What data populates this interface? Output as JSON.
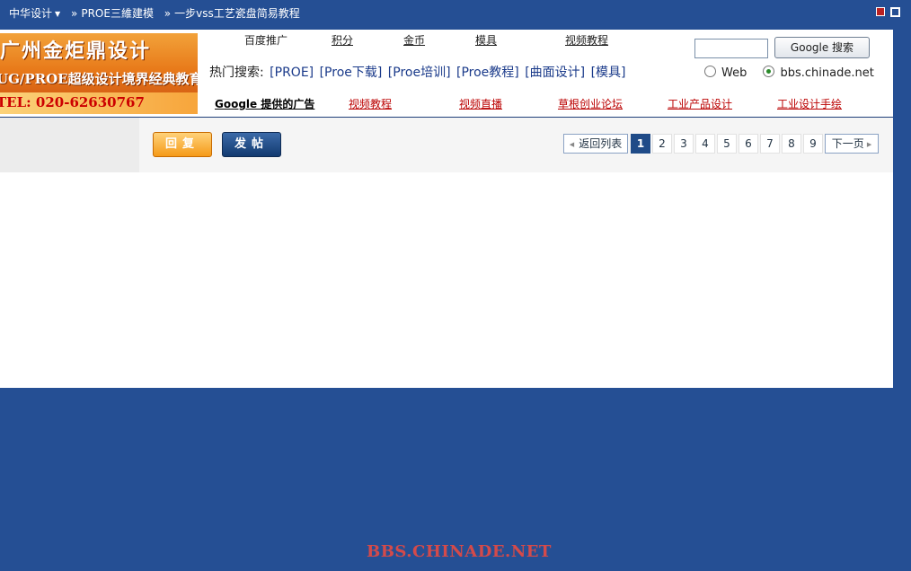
{
  "breadcrumb": {
    "home": "中华设计",
    "forum": "PROE三維建模",
    "thread": "一步vss工艺瓷盘简易教程"
  },
  "banner": {
    "line1": "广州金炬鼎设计",
    "line2": "UG/PROE超级设计境界经典教育",
    "line3": "TEL: 020-62630767"
  },
  "top_links": [
    "百度推广",
    "积分",
    "金币",
    "模具",
    "视频教程"
  ],
  "hot_search": {
    "label": "热门搜索:",
    "items": [
      "[PROE]",
      "[Proe下载]",
      "[Proe培训]",
      "[Proe教程]",
      "[曲面设计]",
      "[模具]"
    ]
  },
  "search": {
    "input_value": "",
    "button_label": "Google 搜索",
    "option_web": "Web",
    "option_site": "bbs.chinade.net",
    "selected": "bbs.chinade.net"
  },
  "ad_links": {
    "google": "Google 提供的广告",
    "items": [
      "视频教程",
      "视频直播",
      "草根创业论坛",
      "工业产品设计",
      "工业设计手绘"
    ]
  },
  "toolbar": {
    "reply_label": "回复",
    "post_label": "发帖"
  },
  "pagination": {
    "back_label": "返回列表",
    "pages": [
      "1",
      "2",
      "3",
      "4",
      "5",
      "6",
      "7",
      "8",
      "9"
    ],
    "current": "1",
    "next_label": "下一页"
  },
  "watermark": "BBS.CHINADE.NET",
  "colors": {
    "page_bg": "#254f94",
    "accent_orange": "#f59a18",
    "accent_navy": "#1f4b88",
    "ad_red": "#bb0000"
  }
}
